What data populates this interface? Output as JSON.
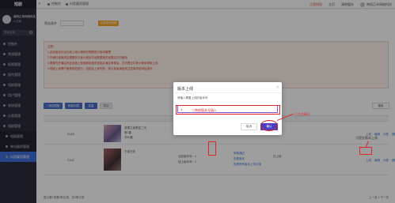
{
  "sidebar": {
    "logo": "短剧",
    "user_name": "南阳正禾网络科技",
    "user_status": "● 在线",
    "search_placeholder": "搜索菜单",
    "items": [
      {
        "label": "控制台"
      },
      {
        "label": "常规管理"
      },
      {
        "label": "权限管理"
      },
      {
        "label": "插件管理"
      },
      {
        "label": "短剧管理"
      },
      {
        "label": "用户管理"
      },
      {
        "label": "系统管理"
      },
      {
        "label": "分类管理"
      },
      {
        "label": "短剧管理"
      }
    ],
    "sub_items": [
      {
        "label": "短剧管理"
      },
      {
        "label": "单位级别管理"
      },
      {
        "label": "抖音媒资管理"
      }
    ]
  },
  "topbar": {
    "menu_icon": "≡",
    "tabs": [
      {
        "label": "控制台"
      },
      {
        "label": "抖音媒资管理"
      }
    ],
    "right": [
      {
        "label": "正版授权"
      },
      {
        "label": "主页"
      },
      {
        "label": "清除缓存"
      },
      {
        "label": "南阳正禾网络科技"
      }
    ]
  },
  "filter": {
    "label": "筛选条件",
    "select_value": "",
    "orange_button": "抖音媒资管理"
  },
  "notice": {
    "lines": [
      "注意：",
      "1.此页面仅针对已经上线小程序的短剧进行版本管理",
      "2.开通抖音媒资后需要在抖音小程序平台配置相关参数后方可使用",
      "3.需要在开通后的此页面上传视频及相关信息并通过审核后，方可提交抖音小程序审核上线",
      "4.视频上传需严格按规范进行，否则会上传失败，请认真阅读相关注意事项说明后操作"
    ]
  },
  "toolbar": {
    "buttons": [
      {
        "label": "+ 添加短剧"
      },
      {
        "label": "刷新列表"
      },
      {
        "label": "批量"
      },
      {
        "label": "导出"
      }
    ],
    "search_label": "搜索"
  },
  "table": {
    "rows": [
      {
        "id": "2143",
        "title": "赘婿之我是富二代",
        "meta": [
          "第1集",
          "共80集"
        ],
        "owner": "",
        "actions": [
          "上线",
          "编辑",
          "分配",
          "删除",
          "更多"
        ]
      },
      {
        "id": "2142",
        "title": "王者归来",
        "meta": [
          "当前版本号：1",
          "线上版本号：1"
        ],
        "link": "审核通过",
        "link2": "查看版本",
        "link3": "查看所有版本上传记录",
        "status": "已上线",
        "actions": [
          "上线",
          "编辑",
          "分配",
          "删除",
          "更多"
        ]
      }
    ]
  },
  "pager": {
    "left": "显示第1到第2条记录，共2条记录",
    "right": "上一页  1  下一页"
  },
  "dialog": {
    "title": "版本上线",
    "close": "×",
    "prompt": "请输入需要上线的版本号",
    "input_value": "1",
    "cancel": "取消",
    "ok": "确认"
  },
  "annotations": {
    "step1": "①审核版本号填入",
    "step2": "②点击确认",
    "step3": "③提交版本上线",
    "color": "#e0262b"
  }
}
